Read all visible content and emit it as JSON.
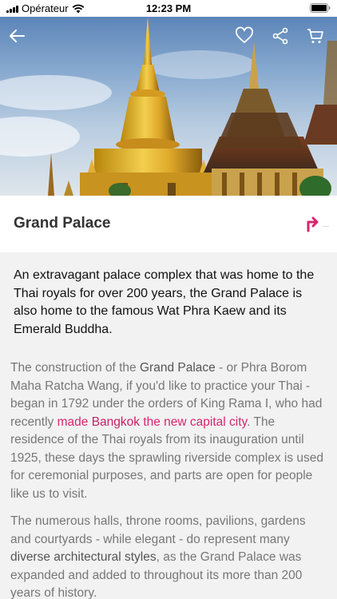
{
  "status": {
    "carrier": "Opérateur",
    "time": "12:23 PM"
  },
  "hero": {
    "alt": "Grand Palace golden stupa"
  },
  "place": {
    "title": "Grand Palace",
    "directions_suffix": "..."
  },
  "intro": "An extravagant palace complex that was home to the Thai royals for over 200 years, the Grand Palace is also home to the famous Wat Phra Kaew and its Emerald Buddha.",
  "p1": {
    "a": "The construction of the ",
    "b": "Grand Palace",
    "c": " - or Phra Borom Maha Ratcha Wang, if you'd like to practice your Thai - began in 1792 under the orders of King Rama I, who had recently ",
    "link_1": "made ",
    "link_2": "Bangkok",
    "link_3": " the new capital city",
    "d": ". The residence of the Thai royals from its inauguration until 1925, these days the sprawling riverside complex is used for ceremonial purposes, and parts are open for people like us to visit."
  },
  "p2": {
    "a": "The numerous halls, throne rooms, pavilions, gardens and courtyards - while elegant - do represent many ",
    "b": "diverse architectural styles",
    "c": ", as the Grand Palace was expanded and added to throughout its more than 200 years of history."
  },
  "colors": {
    "accent": "#d6266f",
    "title": "#333333",
    "body": "#777777"
  }
}
